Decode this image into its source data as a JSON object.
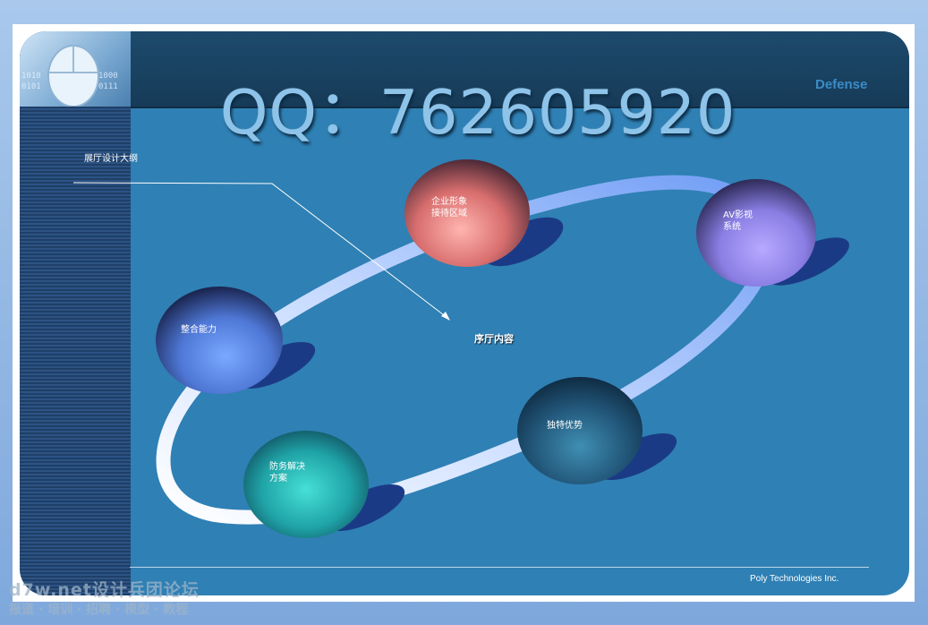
{
  "watermark_qq": "QQ：762605920",
  "brand_word": "Defense",
  "outline_title": "展厅设计大纲",
  "center_text": "序厅内容",
  "nodes": [
    {
      "name": "corporate-image",
      "line1": "企业形象",
      "line2": "接待区域",
      "color": "#e07878"
    },
    {
      "name": "av-system",
      "line1": "AV影视",
      "line2": "系统",
      "color": "#9a8ef0"
    },
    {
      "name": "integration",
      "line1": "整合能力",
      "line2": "",
      "color": "#5f8ff0"
    },
    {
      "name": "advantage",
      "line1": "独特优势",
      "line2": "",
      "color": "#2f6f94"
    },
    {
      "name": "defense-solution",
      "line1": "防务解决",
      "line2": "方案",
      "color": "#2ec3c0"
    }
  ],
  "footer": "Poly Technologies Inc.",
  "site_watermark": {
    "line1": "d7w.net设计兵团论坛",
    "line2": "报道 · 培训 · 招聘 · 模型 · 教程"
  }
}
